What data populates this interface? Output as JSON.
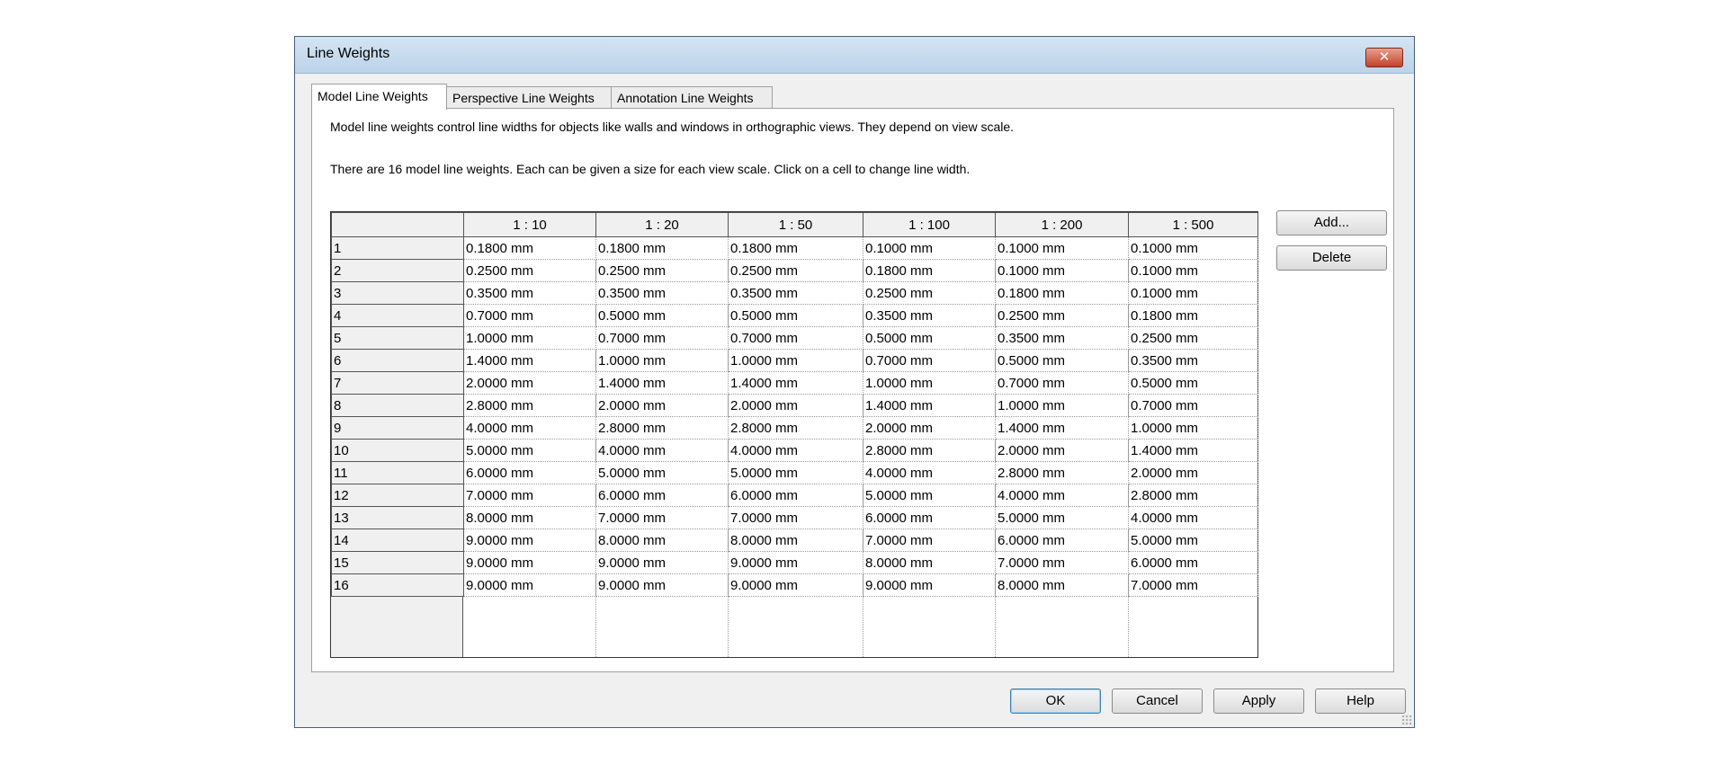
{
  "window": {
    "title": "Line Weights",
    "close_glyph": "✕"
  },
  "tabs": [
    {
      "label": "Model Line Weights",
      "active": true
    },
    {
      "label": "Perspective Line Weights",
      "active": false
    },
    {
      "label": "Annotation Line Weights",
      "active": false
    }
  ],
  "description": {
    "line1": "Model line weights control line widths for objects like walls and windows in orthographic views. They depend on view scale.",
    "line2": "There are 16 model line weights. Each can be given a size for each view scale. Click on a cell to change line width."
  },
  "table": {
    "columns": [
      "1 : 10",
      "1 : 20",
      "1 : 50",
      "1 : 100",
      "1 : 200",
      "1 : 500"
    ],
    "rows": [
      {
        "label": "1",
        "cells": [
          "0.1800 mm",
          "0.1800 mm",
          "0.1800 mm",
          "0.1000 mm",
          "0.1000 mm",
          "0.1000 mm"
        ]
      },
      {
        "label": "2",
        "cells": [
          "0.2500 mm",
          "0.2500 mm",
          "0.2500 mm",
          "0.1800 mm",
          "0.1000 mm",
          "0.1000 mm"
        ]
      },
      {
        "label": "3",
        "cells": [
          "0.3500 mm",
          "0.3500 mm",
          "0.3500 mm",
          "0.2500 mm",
          "0.1800 mm",
          "0.1000 mm"
        ]
      },
      {
        "label": "4",
        "cells": [
          "0.7000 mm",
          "0.5000 mm",
          "0.5000 mm",
          "0.3500 mm",
          "0.2500 mm",
          "0.1800 mm"
        ]
      },
      {
        "label": "5",
        "cells": [
          "1.0000 mm",
          "0.7000 mm",
          "0.7000 mm",
          "0.5000 mm",
          "0.3500 mm",
          "0.2500 mm"
        ]
      },
      {
        "label": "6",
        "cells": [
          "1.4000 mm",
          "1.0000 mm",
          "1.0000 mm",
          "0.7000 mm",
          "0.5000 mm",
          "0.3500 mm"
        ]
      },
      {
        "label": "7",
        "cells": [
          "2.0000 mm",
          "1.4000 mm",
          "1.4000 mm",
          "1.0000 mm",
          "0.7000 mm",
          "0.5000 mm"
        ]
      },
      {
        "label": "8",
        "cells": [
          "2.8000 mm",
          "2.0000 mm",
          "2.0000 mm",
          "1.4000 mm",
          "1.0000 mm",
          "0.7000 mm"
        ]
      },
      {
        "label": "9",
        "cells": [
          "4.0000 mm",
          "2.8000 mm",
          "2.8000 mm",
          "2.0000 mm",
          "1.4000 mm",
          "1.0000 mm"
        ]
      },
      {
        "label": "10",
        "cells": [
          "5.0000 mm",
          "4.0000 mm",
          "4.0000 mm",
          "2.8000 mm",
          "2.0000 mm",
          "1.4000 mm"
        ]
      },
      {
        "label": "11",
        "cells": [
          "6.0000 mm",
          "5.0000 mm",
          "5.0000 mm",
          "4.0000 mm",
          "2.8000 mm",
          "2.0000 mm"
        ]
      },
      {
        "label": "12",
        "cells": [
          "7.0000 mm",
          "6.0000 mm",
          "6.0000 mm",
          "5.0000 mm",
          "4.0000 mm",
          "2.8000 mm"
        ]
      },
      {
        "label": "13",
        "cells": [
          "8.0000 mm",
          "7.0000 mm",
          "7.0000 mm",
          "6.0000 mm",
          "5.0000 mm",
          "4.0000 mm"
        ]
      },
      {
        "label": "14",
        "cells": [
          "9.0000 mm",
          "8.0000 mm",
          "8.0000 mm",
          "7.0000 mm",
          "6.0000 mm",
          "5.0000 mm"
        ]
      },
      {
        "label": "15",
        "cells": [
          "9.0000 mm",
          "9.0000 mm",
          "9.0000 mm",
          "8.0000 mm",
          "7.0000 mm",
          "6.0000 mm"
        ]
      },
      {
        "label": "16",
        "cells": [
          "9.0000 mm",
          "9.0000 mm",
          "9.0000 mm",
          "9.0000 mm",
          "8.0000 mm",
          "7.0000 mm"
        ]
      }
    ]
  },
  "side_buttons": {
    "add": "Add...",
    "delete": "Delete"
  },
  "footer_buttons": {
    "ok": "OK",
    "cancel": "Cancel",
    "apply": "Apply",
    "help": "Help"
  }
}
